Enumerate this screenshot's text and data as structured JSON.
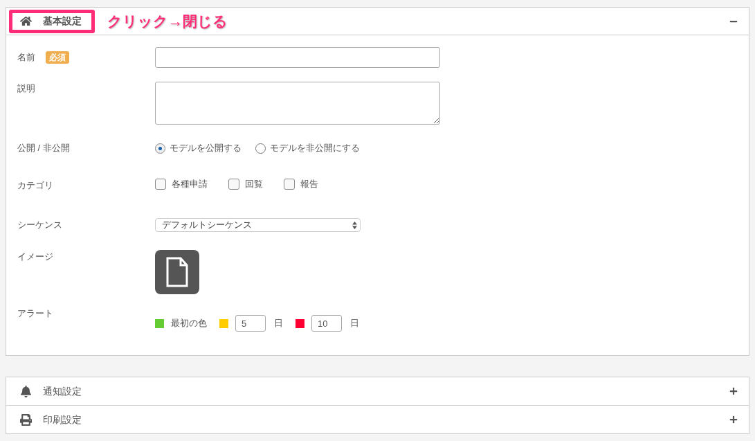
{
  "annotation": {
    "text": "クリック→閉じる"
  },
  "panels": [
    {
      "title": "基本設定",
      "expanded": true,
      "highlighted": true,
      "form": [
        {
          "kind": "text",
          "label": "名前",
          "badge": "必須"
        },
        {
          "kind": "textarea",
          "label": "説明"
        },
        {
          "kind": "radio",
          "label": "公開 / 非公開",
          "options": [
            {
              "label": "モデルを公開する",
              "selected": true
            },
            {
              "label": "モデルを非公開にする",
              "selected": false
            }
          ]
        },
        {
          "kind": "checkbox",
          "label": "カテゴリ",
          "options": [
            {
              "label": "各種申請",
              "checked": false
            },
            {
              "label": "回覧",
              "checked": false
            },
            {
              "label": "報告",
              "checked": false
            }
          ]
        },
        {
          "kind": "select",
          "label": "シーケンス",
          "value": "デフォルトシーケンス"
        },
        {
          "kind": "image",
          "label": "イメージ"
        },
        {
          "kind": "alert",
          "label": "アラート",
          "items": [
            {
              "color": "#66cc33",
              "label": "最初の色"
            },
            {
              "color": "#ffcc00",
              "value": "5",
              "unit": "日"
            },
            {
              "color": "#ff0033",
              "value": "10",
              "unit": "日"
            }
          ]
        }
      ]
    },
    {
      "title": "通知設定",
      "expanded": false,
      "highlighted": false
    },
    {
      "title": "印刷設定",
      "expanded": false,
      "highlighted": false
    }
  ]
}
